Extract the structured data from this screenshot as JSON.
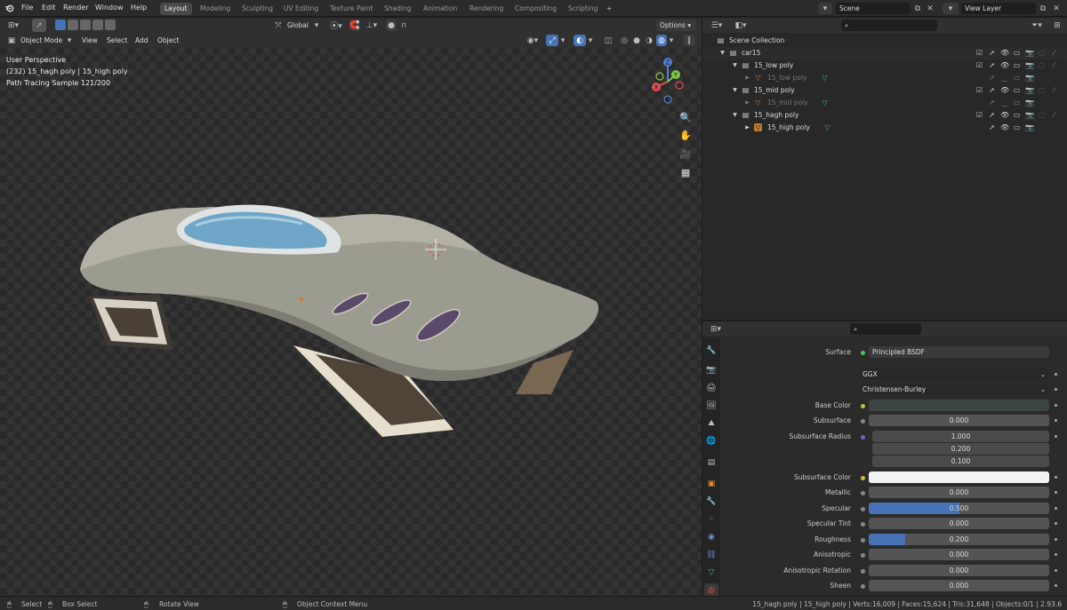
{
  "topbar": {
    "menus": [
      "File",
      "Edit",
      "Render",
      "Window",
      "Help"
    ],
    "workspaces": [
      "Layout",
      "Modeling",
      "Sculpting",
      "UV Editing",
      "Texture Paint",
      "Shading",
      "Animation",
      "Rendering",
      "Compositing",
      "Scripting"
    ],
    "active_workspace": "Layout",
    "add_tab": "+",
    "scene_label": "Scene",
    "view_layer_label": "View Layer"
  },
  "viewport_header": {
    "transform_orientation": "Global",
    "options_label": "Options",
    "mode": "Object Mode",
    "menus": [
      "View",
      "Select",
      "Add",
      "Object"
    ]
  },
  "viewport": {
    "perspective": "User Perspective",
    "object_info": "(232) 15_hagh poly | 15_high poly",
    "render_status": "Path Tracing Sample 121/200",
    "gizmo_axes": [
      "Z",
      "Y",
      "X"
    ]
  },
  "outliner": {
    "search_placeholder": "",
    "root": "Scene Collection",
    "items": [
      {
        "label": "car15",
        "dim": false
      },
      {
        "label": "15_low poly",
        "dim": false
      },
      {
        "label": "15_low poly",
        "dim": true
      },
      {
        "label": "15_mid poly",
        "dim": false
      },
      {
        "label": "15_mid poly",
        "dim": true
      },
      {
        "label": "15_hagh poly",
        "dim": false
      },
      {
        "label": "15_high poly",
        "dim": false
      }
    ]
  },
  "properties": {
    "surface_label": "Surface",
    "surface_value": "Principled BSDF",
    "distribution": "GGX",
    "subsurface_method": "Christensen-Burley",
    "base_color_label": "Base Color",
    "subsurface_label": "Subsurface",
    "subsurface_value": "0.000",
    "subsurface_radius_label": "Subsurface Radius",
    "subsurface_radius": [
      "1.000",
      "0.200",
      "0.100"
    ],
    "subsurface_color_label": "Subsurface Color",
    "metallic_label": "Metallic",
    "metallic_value": "0.000",
    "specular_label": "Specular",
    "specular_value": "0.500",
    "specular_tint_label": "Specular Tint",
    "specular_tint_value": "0.000",
    "roughness_label": "Roughness",
    "roughness_value": "0.200",
    "anisotropic_label": "Anisotropic",
    "anisotropic_value": "0.000",
    "anisotropic_rotation_label": "Anisotropic Rotation",
    "anisotropic_rotation_value": "0.000",
    "sheen_label": "Sheen",
    "sheen_value": "0.000"
  },
  "statusbar": {
    "select": "Select",
    "box_select": "Box Select",
    "rotate_view": "Rotate View",
    "context_menu": "Object Context Menu",
    "stats": "15_hagh poly | 15_high poly | Verts:16,009 | Faces:15,624 | Tris:31,648 | Objects:0/1 | 2.93.6"
  },
  "colors": {
    "accent": "#4772b3",
    "body_paint": "#9a9a90",
    "canopy": "#6fa6c8",
    "vents": "#5a4a6a"
  }
}
